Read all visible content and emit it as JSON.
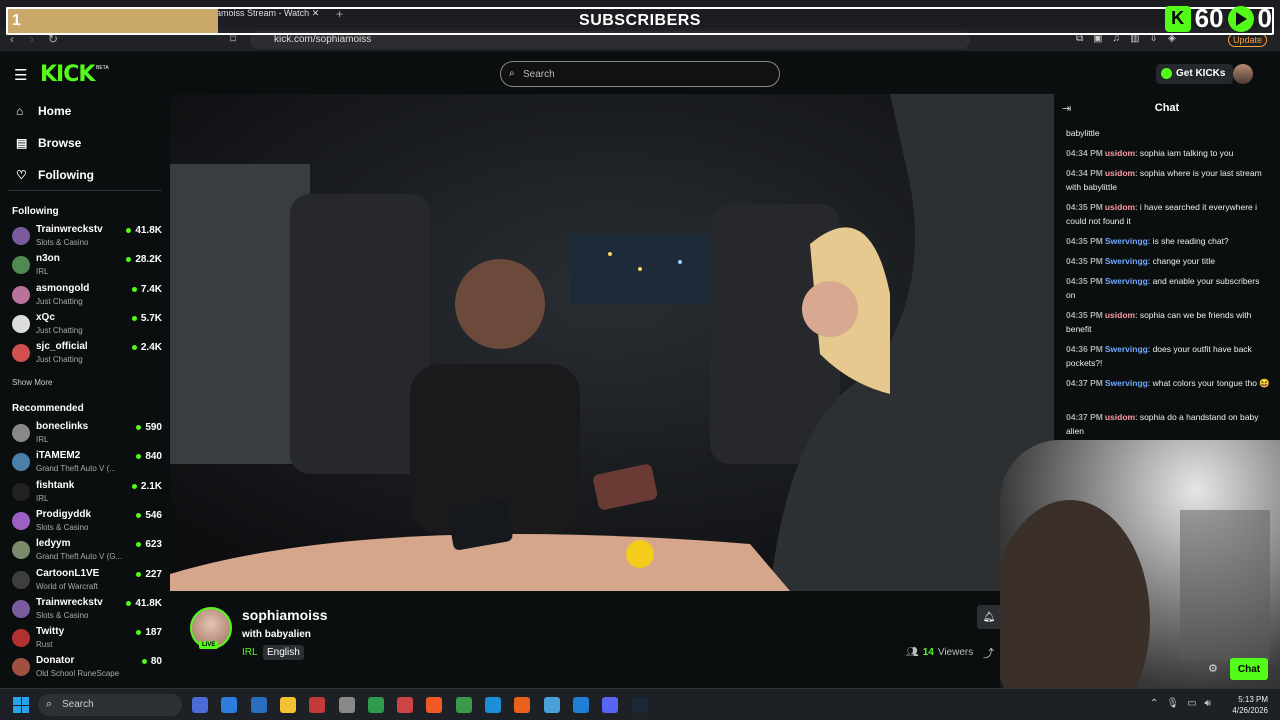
{
  "overlay": {
    "goal_count": "1",
    "goal_title": "SUBSCRIBERS",
    "goal_target": "60",
    "goal_right_digit": "0"
  },
  "browser": {
    "tab_title": "amoiss Stream - Watch",
    "url": "kick.com/sophiamoiss",
    "update_label": "Update"
  },
  "header": {
    "logo": "KICK",
    "beta": "BETA",
    "search_placeholder": "Search",
    "get_kicks": "Get KICKs"
  },
  "sidebar": {
    "nav": [
      {
        "label": "Home",
        "icon": "home-icon"
      },
      {
        "label": "Browse",
        "icon": "browse-icon"
      },
      {
        "label": "Following",
        "icon": "heart-icon"
      }
    ],
    "following_title": "Following",
    "following": [
      {
        "name": "Trainwreckstv",
        "category": "Slots & Casino",
        "viewers": "41.8K",
        "color": "#7a5c9e"
      },
      {
        "name": "n3on",
        "category": "IRL",
        "viewers": "28.2K",
        "color": "#4f8a52"
      },
      {
        "name": "asmongold",
        "category": "Just Chatting",
        "viewers": "7.4K",
        "color": "#b9729a"
      },
      {
        "name": "xQc",
        "category": "Just Chatting",
        "viewers": "5.7K",
        "color": "#dddddd"
      },
      {
        "name": "sjc_official",
        "category": "Just Chatting",
        "viewers": "2.4K",
        "color": "#d05050"
      }
    ],
    "show_more": "Show More",
    "recommended_title": "Recommended",
    "recommended": [
      {
        "name": "boneclinks",
        "category": "IRL",
        "viewers": "590",
        "color": "#888888"
      },
      {
        "name": "iTAMEM2",
        "category": "Grand Theft Auto V (...",
        "viewers": "840",
        "color": "#4a7fa8"
      },
      {
        "name": "fishtank",
        "category": "IRL",
        "viewers": "2.1K",
        "color": "#222222"
      },
      {
        "name": "Prodigyddk",
        "category": "Slots & Casino",
        "viewers": "546",
        "color": "#9d5fc4"
      },
      {
        "name": "ledyym",
        "category": "Grand Theft Auto V (G...",
        "viewers": "623",
        "color": "#7a8a6a"
      },
      {
        "name": "CartoonL1VE",
        "category": "World of Warcraft",
        "viewers": "227",
        "color": "#3e3e3e"
      },
      {
        "name": "Trainwreckstv",
        "category": "Slots & Casino",
        "viewers": "41.8K",
        "color": "#7a5c9e"
      },
      {
        "name": "Twitty",
        "category": "Rust",
        "viewers": "187",
        "color": "#b23030"
      },
      {
        "name": "Donator",
        "category": "Old School RuneScape",
        "viewers": "80",
        "color": "#a05040"
      }
    ]
  },
  "stream": {
    "channel": "sophiamoiss",
    "title": "with babyalien",
    "live": "LIVE",
    "category": "IRL",
    "language": "English",
    "viewers": "14",
    "viewers_label": "Viewers"
  },
  "chat": {
    "title": "Chat",
    "button": "Chat",
    "messages": [
      {
        "time": "",
        "user": "",
        "text": "babylittle",
        "ucls": "u1"
      },
      {
        "time": "04:34 PM",
        "user": "usidom",
        "text": "sophia iam talking to you",
        "ucls": "u1"
      },
      {
        "time": "04:34 PM",
        "user": "usidom",
        "text": "sophia where is your last stream with babylittle",
        "ucls": "u1"
      },
      {
        "time": "04:35 PM",
        "user": "usidom",
        "text": "i have searched it everywhere i could not found it",
        "ucls": "u1"
      },
      {
        "time": "04:35 PM",
        "user": "Swervingg",
        "text": "is she reading chat?",
        "ucls": "u2"
      },
      {
        "time": "04:35 PM",
        "user": "Swervingg",
        "text": "change your title",
        "ucls": "u2"
      },
      {
        "time": "04:35 PM",
        "user": "Swervingg",
        "text": "and enable your subscribers on",
        "ucls": "u2"
      },
      {
        "time": "04:35 PM",
        "user": "usidom",
        "text": "sophia can we be friends with benefit",
        "ucls": "u1"
      },
      {
        "time": "04:36 PM",
        "user": "Swervingg",
        "text": "does your outfit have back pockets?!",
        "ucls": "u2"
      },
      {
        "time": "04:37 PM",
        "user": "Swervingg",
        "text": "what colors your tongue tho 😆",
        "ucls": "u2"
      },
      {
        "time": "04:37 PM",
        "user": "usidom",
        "text": "sophia do a handstand on baby alien",
        "ucls": "u1"
      }
    ]
  },
  "taskbar": {
    "search": "Search",
    "time": "5:13 PM",
    "date": "4/26/2026"
  },
  "colors": {
    "accent": "#53fc18",
    "goal_fill": "#c9a86a"
  }
}
